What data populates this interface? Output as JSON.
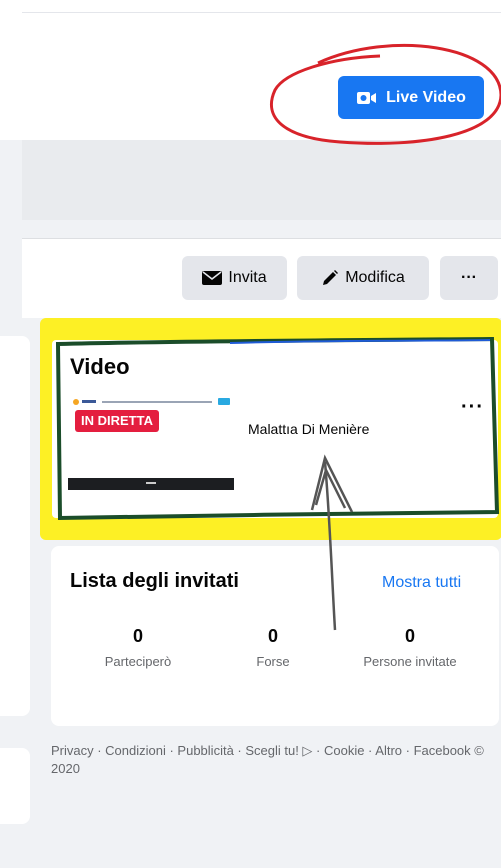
{
  "header": {
    "live_video_label": "Live Video"
  },
  "actions": {
    "invite_label": "Invita",
    "edit_label": "Modifica",
    "more_label": "···"
  },
  "video": {
    "title": "Video",
    "live_badge": "IN DIRETTA",
    "name": "Malattıa Di Menière",
    "more_label": "···"
  },
  "guests": {
    "title": "Lista degli invitati",
    "show_all": "Mostra tutti",
    "stats": [
      {
        "value": "0",
        "label": "Parteciperò"
      },
      {
        "value": "0",
        "label": "Forse"
      },
      {
        "value": "0",
        "label": "Persone invitate"
      }
    ]
  },
  "footer": {
    "text": "Privacy · Condizioni · Pubblicità · Scegli tu! ▷ · Cookie · Altro · Facebook © 2020"
  },
  "colors": {
    "accent": "#1877f2",
    "live": "#e41e3f",
    "highlight": "#fff000"
  }
}
